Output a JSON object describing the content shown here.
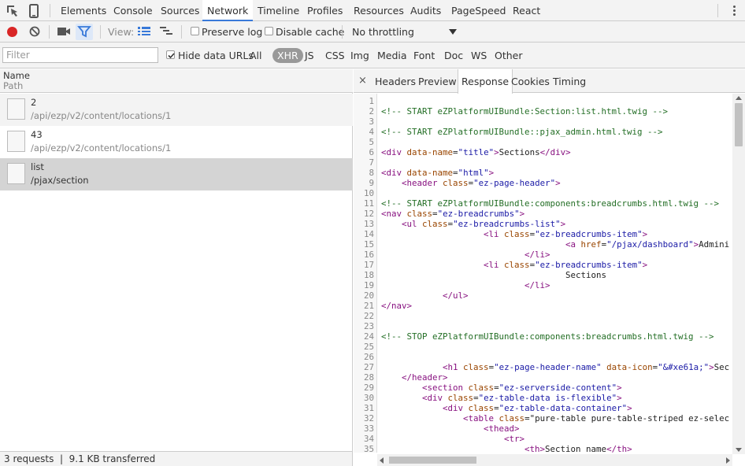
{
  "tabbar": {
    "tabs": [
      {
        "label": "Elements"
      },
      {
        "label": "Console"
      },
      {
        "label": "Sources"
      },
      {
        "label": "Network",
        "active": true
      },
      {
        "label": "Timeline"
      },
      {
        "label": "Profiles"
      },
      {
        "label": "Resources"
      },
      {
        "label": "Audits"
      },
      {
        "label": "PageSpeed"
      },
      {
        "label": "React"
      }
    ]
  },
  "toolbar": {
    "view_label": "View:",
    "preserve_log_label": "Preserve log",
    "disable_cache_label": "Disable cache",
    "throttle_value": "No throttling"
  },
  "filterbar": {
    "placeholder": "Filter",
    "hide_data_urls_label": "Hide data URLs",
    "types": [
      "All",
      "XHR",
      "JS",
      "CSS",
      "Img",
      "Media",
      "Font",
      "Doc",
      "WS",
      "Other"
    ],
    "active_type": "XHR"
  },
  "requests": {
    "header_name": "Name",
    "header_path": "Path",
    "rows": [
      {
        "name": "2",
        "path": "/api/ezp/v2/content/locations/1"
      },
      {
        "name": "43",
        "path": "/api/ezp/v2/content/locations/1"
      },
      {
        "name": "list",
        "path": "/pjax/section"
      }
    ]
  },
  "status": {
    "text": "3 requests  |  9.1 KB transferred"
  },
  "detail": {
    "close_glyph": "×",
    "tabs": [
      "Headers",
      "Preview",
      "Response",
      "Cookies",
      "Timing"
    ],
    "active_tab": "Response"
  },
  "response_lines": [
    "",
    "<!-- START eZPlatformUIBundle:Section:list.html.twig -->",
    "",
    "<!-- START eZPlatformUIBundle::pjax_admin.html.twig -->",
    "",
    "<div data-name=\"title\">Sections</div>",
    "",
    "<div data-name=\"html\">",
    "    <header class=\"ez-page-header\">",
    "",
    "<!-- START eZPlatformUIBundle:components:breadcrumbs.html.twig -->",
    "<nav class=\"ez-breadcrumbs\">",
    "    <ul class=\"ez-breadcrumbs-list\">",
    "                    <li class=\"ez-breadcrumbs-item\">",
    "                                    <a href=\"/pjax/dashboard\">Admini",
    "                            </li>",
    "                    <li class=\"ez-breadcrumbs-item\">",
    "                                    Sections",
    "                            </li>",
    "            </ul>",
    "</nav>",
    "",
    "",
    "<!-- STOP eZPlatformUIBundle:components:breadcrumbs.html.twig -->",
    "",
    "",
    "            <h1 class=\"ez-page-header-name\" data-icon=\"&#xe61a;\">Sec",
    "    </header>",
    "        <section class=\"ez-serverside-content\">",
    "        <div class=\"ez-table-data is-flexible\">",
    "            <div class=\"ez-table-data-container\">",
    "                <table class=\"pure-table pure-table-striped ez-selec",
    "                    <thead>",
    "                        <tr>",
    "                            <th>Section name</th>",
    ""
  ]
}
